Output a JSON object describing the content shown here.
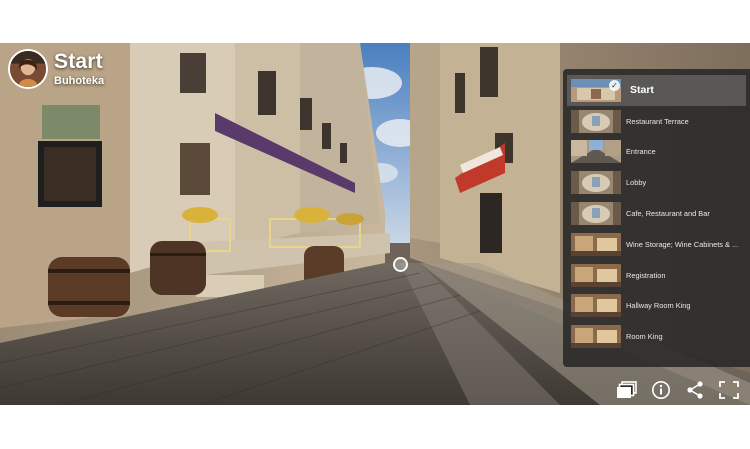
{
  "tour": {
    "title": "Start",
    "subtitle": "Buhoteka"
  },
  "playlist": {
    "items": [
      {
        "label": "Start",
        "active": true,
        "thumb": "lobby"
      },
      {
        "label": "Restaurant Terrace",
        "active": false,
        "thumb": "pano"
      },
      {
        "label": "Entrance",
        "active": false,
        "thumb": "street"
      },
      {
        "label": "Lobby",
        "active": false,
        "thumb": "pano"
      },
      {
        "label": "Cafe, Restaurant and Bar",
        "active": false,
        "thumb": "pano"
      },
      {
        "label": "Wine Storage; Wine Cabinets & ...",
        "active": false,
        "thumb": "warm"
      },
      {
        "label": "Registration",
        "active": false,
        "thumb": "warm"
      },
      {
        "label": "Hallway Room King",
        "active": false,
        "thumb": "warm"
      },
      {
        "label": "Room King",
        "active": false,
        "thumb": "warm"
      }
    ]
  },
  "toolbar": {
    "buttons": [
      "playlist-icon",
      "info-icon",
      "share-icon",
      "fullscreen-icon"
    ]
  },
  "colors": {
    "panel_bg": "#282828",
    "active_row": "#787878",
    "text": "#e8e8e8"
  }
}
